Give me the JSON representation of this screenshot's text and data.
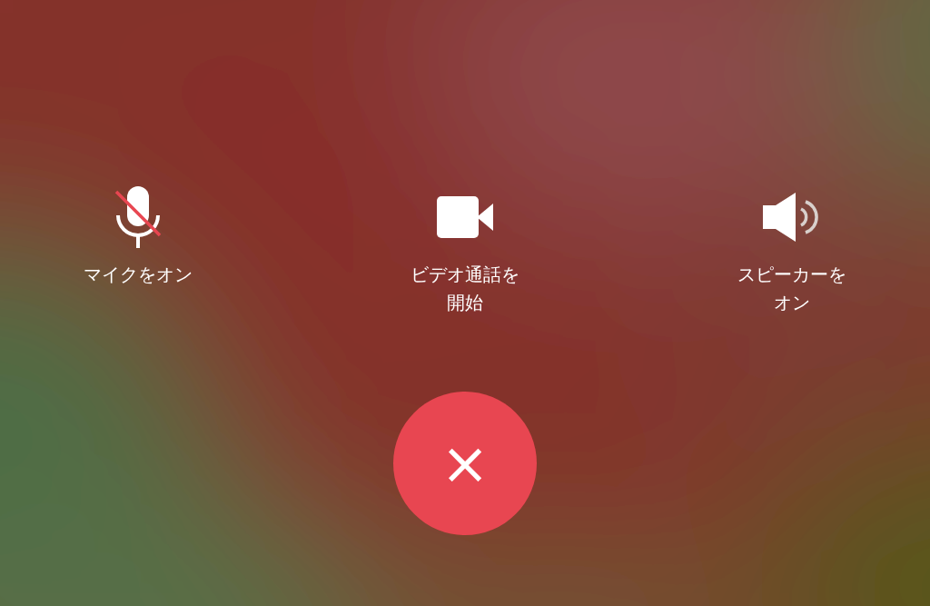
{
  "controls": [
    {
      "kind": "mic",
      "label": "マイクをオン",
      "muted": true
    },
    {
      "kind": "video",
      "label": "ビデオ通話を開始"
    },
    {
      "kind": "speaker",
      "label": "スピーカーをオン"
    }
  ],
  "end_call": {
    "label": "×"
  }
}
